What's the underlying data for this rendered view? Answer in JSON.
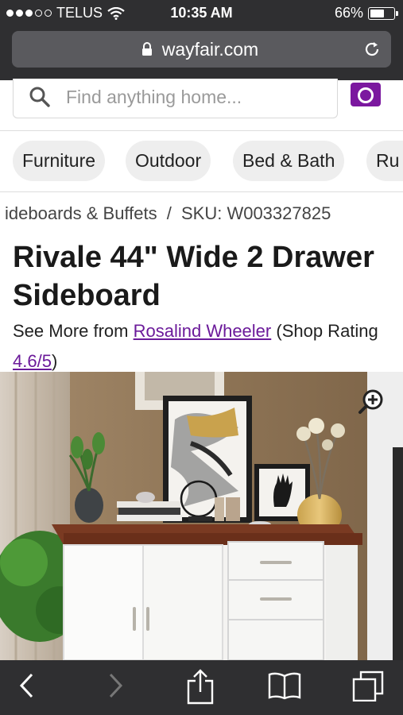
{
  "status": {
    "carrier": "TELUS",
    "time": "10:35 AM",
    "battery": "66%",
    "battery_level": 0.66,
    "signal_bars_filled": 3,
    "signal_bars_total": 5
  },
  "browser": {
    "url": "wayfair.com",
    "lock_icon": "lock-icon",
    "reload_icon": "reload-icon"
  },
  "search": {
    "placeholder": "Find anything home...",
    "icon": "search-icon",
    "camera_icon": "camera-icon"
  },
  "categories": [
    "Furniture",
    "Outdoor",
    "Bed & Bath",
    "Ru"
  ],
  "breadcrumb": {
    "category": "ideboards & Buffets",
    "separator": "/",
    "sku": "SKU: W003327825"
  },
  "product": {
    "title": "Rivale 44\" Wide 2 Drawer Sideboard",
    "see_more_prefix": "See More from ",
    "brand": "Rosalind Wheeler",
    "shop_prefix": " (Shop Rating ",
    "rating": "4.6/5",
    "shop_suffix": ")",
    "zoom_icon": "zoom-in-icon"
  },
  "toolbar": {
    "icons": [
      "back-icon",
      "forward-icon",
      "share-icon",
      "bookmarks-icon",
      "tabs-icon"
    ]
  },
  "colors": {
    "brand_purple": "#7b189f",
    "link_purple": "#6b1a9a",
    "chrome_dark": "#2f2f31"
  }
}
